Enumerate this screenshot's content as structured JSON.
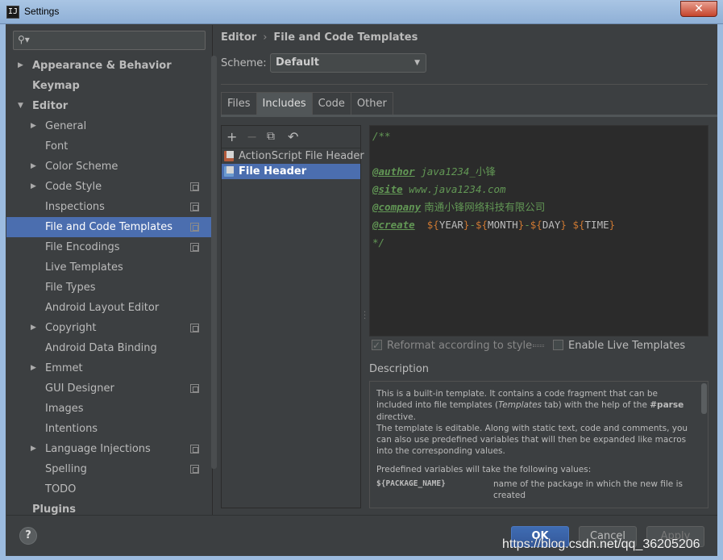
{
  "window": {
    "title": "Settings",
    "close_glyph": "✕",
    "app_icon_text": "IJ"
  },
  "search": {
    "placeholder": "",
    "icon": "search-icon"
  },
  "sidebar": {
    "items": [
      {
        "label": "Appearance & Behavior",
        "level": 0,
        "arrow": "right",
        "bold": true
      },
      {
        "label": "Keymap",
        "level": 0,
        "arrow": "none",
        "bold": true
      },
      {
        "label": "Editor",
        "level": 0,
        "arrow": "down",
        "bold": true
      },
      {
        "label": "General",
        "level": 1,
        "arrow": "right"
      },
      {
        "label": "Font",
        "level": 1,
        "arrow": "none"
      },
      {
        "label": "Color Scheme",
        "level": 1,
        "arrow": "right"
      },
      {
        "label": "Code Style",
        "level": 1,
        "arrow": "right",
        "project_icon": true
      },
      {
        "label": "Inspections",
        "level": 1,
        "arrow": "none",
        "project_icon": true
      },
      {
        "label": "File and Code Templates",
        "level": 1,
        "arrow": "none",
        "project_icon": true,
        "selected": true
      },
      {
        "label": "File Encodings",
        "level": 1,
        "arrow": "none",
        "project_icon": true
      },
      {
        "label": "Live Templates",
        "level": 1,
        "arrow": "none"
      },
      {
        "label": "File Types",
        "level": 1,
        "arrow": "none"
      },
      {
        "label": "Android Layout Editor",
        "level": 1,
        "arrow": "none"
      },
      {
        "label": "Copyright",
        "level": 1,
        "arrow": "right",
        "project_icon": true
      },
      {
        "label": "Android Data Binding",
        "level": 1,
        "arrow": "none"
      },
      {
        "label": "Emmet",
        "level": 1,
        "arrow": "right"
      },
      {
        "label": "GUI Designer",
        "level": 1,
        "arrow": "none",
        "project_icon": true
      },
      {
        "label": "Images",
        "level": 1,
        "arrow": "none"
      },
      {
        "label": "Intentions",
        "level": 1,
        "arrow": "none"
      },
      {
        "label": "Language Injections",
        "level": 1,
        "arrow": "right",
        "project_icon": true
      },
      {
        "label": "Spelling",
        "level": 1,
        "arrow": "none",
        "project_icon": true
      },
      {
        "label": "TODO",
        "level": 1,
        "arrow": "none"
      },
      {
        "label": "Plugins",
        "level": 0,
        "arrow": "none",
        "bold": true
      }
    ]
  },
  "breadcrumb": {
    "parent": "Editor",
    "separator": "›",
    "current": "File and Code Templates"
  },
  "scheme": {
    "label": "Scheme:",
    "value": "Default"
  },
  "tabs": [
    {
      "label": "Files",
      "active": false
    },
    {
      "label": "Includes",
      "active": true
    },
    {
      "label": "Code",
      "active": false
    },
    {
      "label": "Other",
      "active": false
    }
  ],
  "toolbar": {
    "add": "+",
    "remove": "−",
    "copy": "⧉",
    "reset": "↶"
  },
  "templates": [
    {
      "label": "ActionScript File Header",
      "selected": false
    },
    {
      "label": "File Header",
      "selected": true
    }
  ],
  "code": {
    "open": "/**",
    "author_tag": "@author",
    "author_val": " java1234_",
    "author_cn": "小锋",
    "site_tag": "@site",
    "site_val": " www.java1234.com",
    "company_tag": "@company",
    "company_cn": " 南通小锋网络科技有限公司",
    "create_tag": "@create",
    "v_year": "YEAR",
    "v_month": "MONTH",
    "v_day": "DAY",
    "v_time": "TIME",
    "close": "*/"
  },
  "options": {
    "reformat": "Reformat according to style",
    "live": "Enable Live Templates"
  },
  "description": {
    "title": "Description",
    "p1a": "This is a built-in template. It contains a code fragment that can be included into file templates (",
    "p1b": "Templates",
    "p1c": " tab) with the help of the ",
    "p1d": "#parse",
    "p1e": " directive.",
    "p2": "The template is editable. Along with static text, code and comments, you can also use predefined variables that will then be expanded like macros into the corresponding values.",
    "p3": "Predefined variables will take the following values:",
    "var_name": "${PACKAGE_NAME}",
    "var_desc": "name of the package in which the new file is created"
  },
  "buttons": {
    "help": "?",
    "ok": "OK",
    "cancel": "Cancel",
    "apply": "Apply"
  },
  "watermark": "https://blog.csdn.net/qq_36205206"
}
